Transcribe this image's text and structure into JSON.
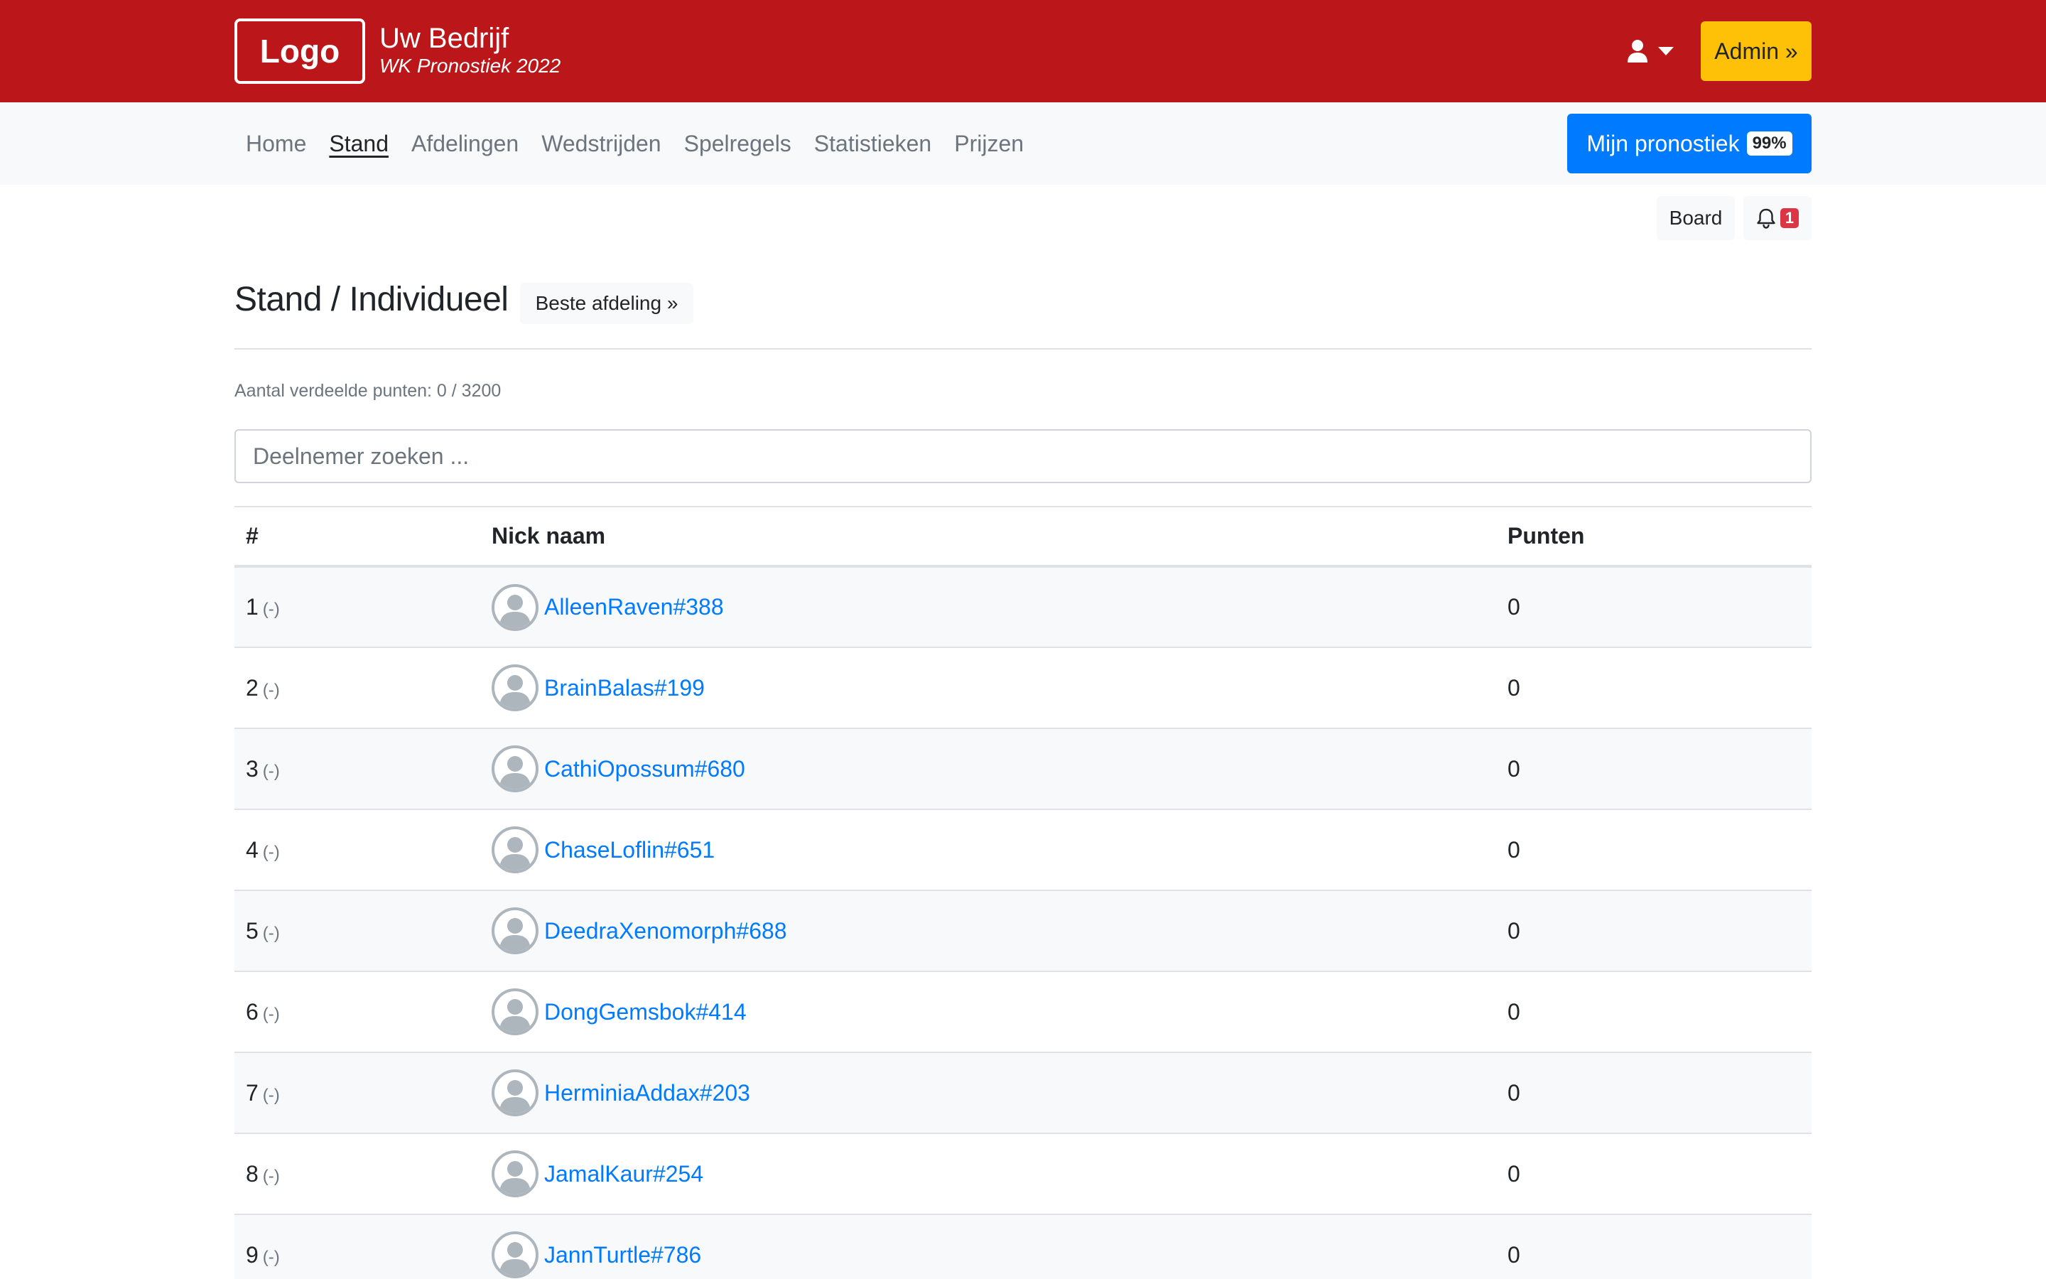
{
  "header": {
    "logo_text": "Logo",
    "company": "Uw Bedrijf",
    "subtitle": "WK Pronostiek 2022",
    "admin_label": "Admin »"
  },
  "nav": {
    "items": [
      {
        "label": "Home",
        "active": false
      },
      {
        "label": "Stand",
        "active": true
      },
      {
        "label": "Afdelingen",
        "active": false
      },
      {
        "label": "Wedstrijden",
        "active": false
      },
      {
        "label": "Spelregels",
        "active": false
      },
      {
        "label": "Statistieken",
        "active": false
      },
      {
        "label": "Prijzen",
        "active": false
      }
    ],
    "mijn_label": "Mijn pronostiek",
    "mijn_badge": "99%"
  },
  "toolbar": {
    "board_label": "Board",
    "notification_count": "1"
  },
  "page": {
    "title": "Stand / Individueel",
    "beste_label": "Beste afdeling »",
    "points_info": "Aantal verdeelde punten: 0 / 3200",
    "search_placeholder": "Deelnemer zoeken ..."
  },
  "table": {
    "headers": {
      "rank": "#",
      "nick": "Nick naam",
      "points": "Punten"
    },
    "rows": [
      {
        "rank": "1",
        "delta": "(-)",
        "nick": "AlleenRaven#388",
        "points": "0"
      },
      {
        "rank": "2",
        "delta": "(-)",
        "nick": "BrainBalas#199",
        "points": "0"
      },
      {
        "rank": "3",
        "delta": "(-)",
        "nick": "CathiOpossum#680",
        "points": "0"
      },
      {
        "rank": "4",
        "delta": "(-)",
        "nick": "ChaseLoflin#651",
        "points": "0"
      },
      {
        "rank": "5",
        "delta": "(-)",
        "nick": "DeedraXenomorph#688",
        "points": "0"
      },
      {
        "rank": "6",
        "delta": "(-)",
        "nick": "DongGemsbok#414",
        "points": "0"
      },
      {
        "rank": "7",
        "delta": "(-)",
        "nick": "HerminiaAddax#203",
        "points": "0"
      },
      {
        "rank": "8",
        "delta": "(-)",
        "nick": "JamalKaur#254",
        "points": "0"
      },
      {
        "rank": "9",
        "delta": "(-)",
        "nick": "JannTurtle#786",
        "points": "0"
      }
    ]
  },
  "colors": {
    "brand_red": "#bb1619",
    "admin_yellow": "#ffc107",
    "primary_blue": "#007bff",
    "badge_red": "#dc3545"
  },
  "icons": {
    "user": "user-icon",
    "caret": "caret-down-icon",
    "bell": "bell-icon",
    "avatar": "avatar-icon"
  }
}
